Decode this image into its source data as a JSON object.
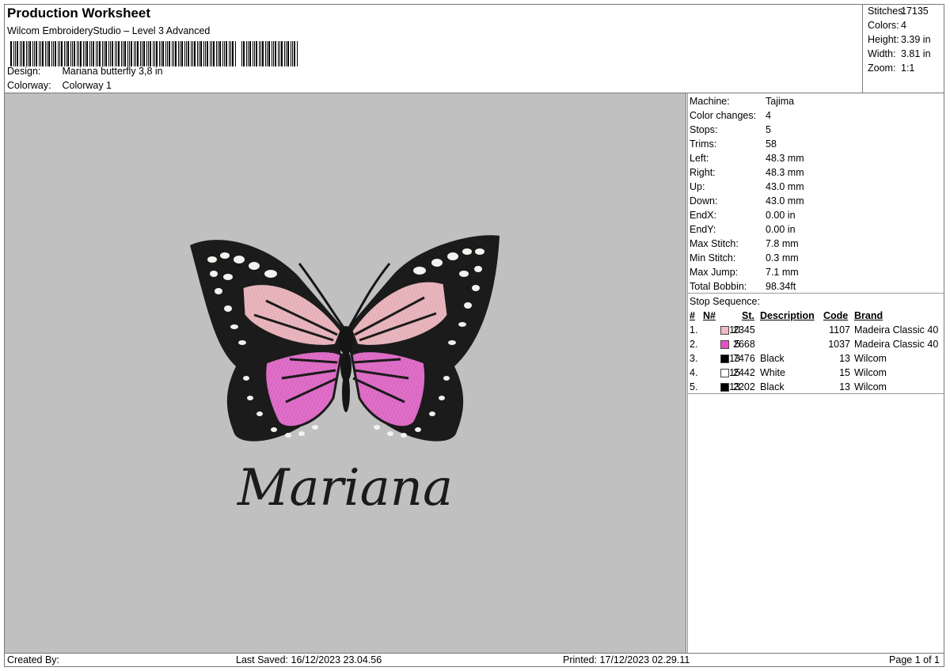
{
  "header": {
    "title": "Production Worksheet",
    "software": "Wilcom EmbroideryStudio – Level 3 Advanced",
    "design_label": "Design:",
    "design_value": "Mariana butterfly 3,8 in",
    "colorway_label": "Colorway:",
    "colorway_value": "Colorway 1"
  },
  "stats": [
    {
      "label": "Stitches:",
      "value": "17135"
    },
    {
      "label": "Colors:",
      "value": "4"
    },
    {
      "label": "Height:",
      "value": "3.39 in"
    },
    {
      "label": "Width:",
      "value": "3.81 in"
    },
    {
      "label": "Zoom:",
      "value": "1:1"
    }
  ],
  "machine_info": [
    {
      "label": "Machine:",
      "value": "Tajima"
    },
    {
      "label": "Color changes:",
      "value": "4"
    },
    {
      "label": "Stops:",
      "value": "5"
    },
    {
      "label": "Trims:",
      "value": "58"
    },
    {
      "label": "Left:",
      "value": "48.3 mm"
    },
    {
      "label": "Right:",
      "value": "48.3 mm"
    },
    {
      "label": "Up:",
      "value": "43.0 mm"
    },
    {
      "label": "Down:",
      "value": "43.0 mm"
    },
    {
      "label": "EndX:",
      "value": "0.00 in"
    },
    {
      "label": "EndY:",
      "value": "0.00 in"
    },
    {
      "label": "Max Stitch:",
      "value": "7.8 mm"
    },
    {
      "label": "Min Stitch:",
      "value": "0.3 mm"
    },
    {
      "label": "Max Jump:",
      "value": "7.1 mm"
    },
    {
      "label": "Total Bobbin:",
      "value": "98.34ft"
    }
  ],
  "stop_sequence": {
    "title": "Stop Sequence:",
    "headers": {
      "num": "#",
      "n": "N#",
      "st": "St.",
      "description": "Description",
      "code": "Code",
      "brand": "Brand"
    },
    "rows": [
      {
        "num": "1.",
        "n": "10",
        "color": "#f2b8c6",
        "st": "2345",
        "description": "",
        "code": "1107",
        "brand": "Madeira Classic 40"
      },
      {
        "num": "2.",
        "n": "5",
        "color": "#e84fc0",
        "st": "2668",
        "description": "",
        "code": "1037",
        "brand": "Madeira Classic 40"
      },
      {
        "num": "3.",
        "n": "13",
        "color": "#000000",
        "st": "7476",
        "description": "Black",
        "code": "13",
        "brand": "Wilcom"
      },
      {
        "num": "4.",
        "n": "15",
        "color": "#ffffff",
        "st": "2442",
        "description": "White",
        "code": "15",
        "brand": "Wilcom"
      },
      {
        "num": "5.",
        "n": "13",
        "color": "#000000",
        "st": "2202",
        "description": "Black",
        "code": "13",
        "brand": "Wilcom"
      }
    ]
  },
  "design_preview": {
    "script_text": "Mariana"
  },
  "footer": {
    "created_by": "Created By:",
    "last_saved": "Last Saved: 16/12/2023 23.04.56",
    "printed": "Printed: 17/12/2023 02.29.11",
    "page": "Page 1 of 1"
  }
}
